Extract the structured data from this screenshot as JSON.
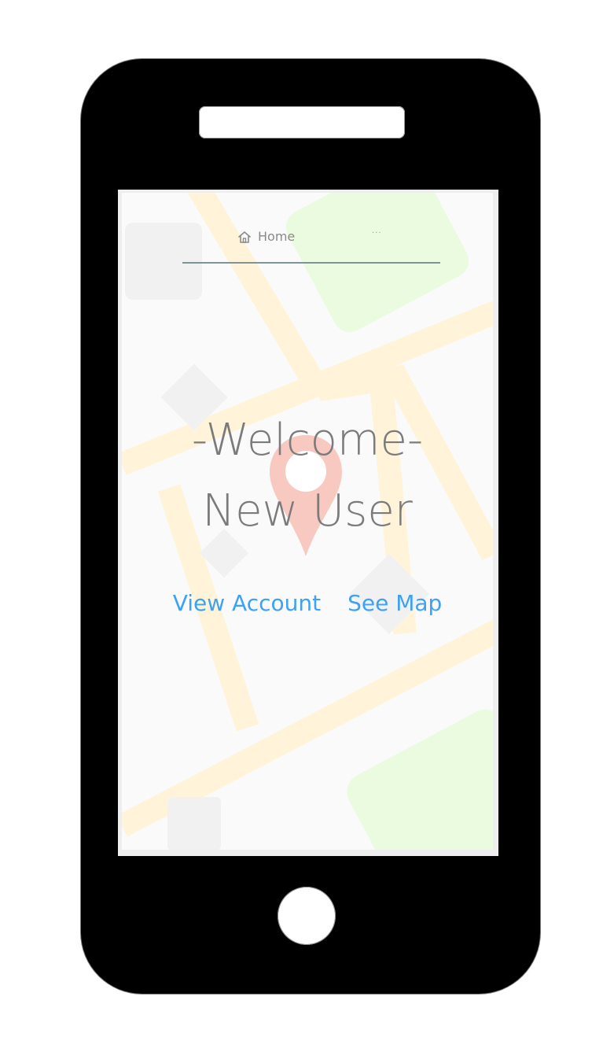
{
  "nav": {
    "home_label": "Home",
    "home_icon": "home-icon",
    "more_label": "···"
  },
  "hero": {
    "line1": "-Welcome-",
    "line2": "New User"
  },
  "actions": {
    "view_account": "View Account",
    "see_map": "See Map"
  },
  "colors": {
    "link": "#3da1f4",
    "heading": "#7b7b7b",
    "nav_underline": "#7e9497",
    "phone_body": "#000000",
    "map_road": "#fff4d9",
    "map_park": "#eafbe0",
    "map_pin": "#f7c9c1"
  }
}
